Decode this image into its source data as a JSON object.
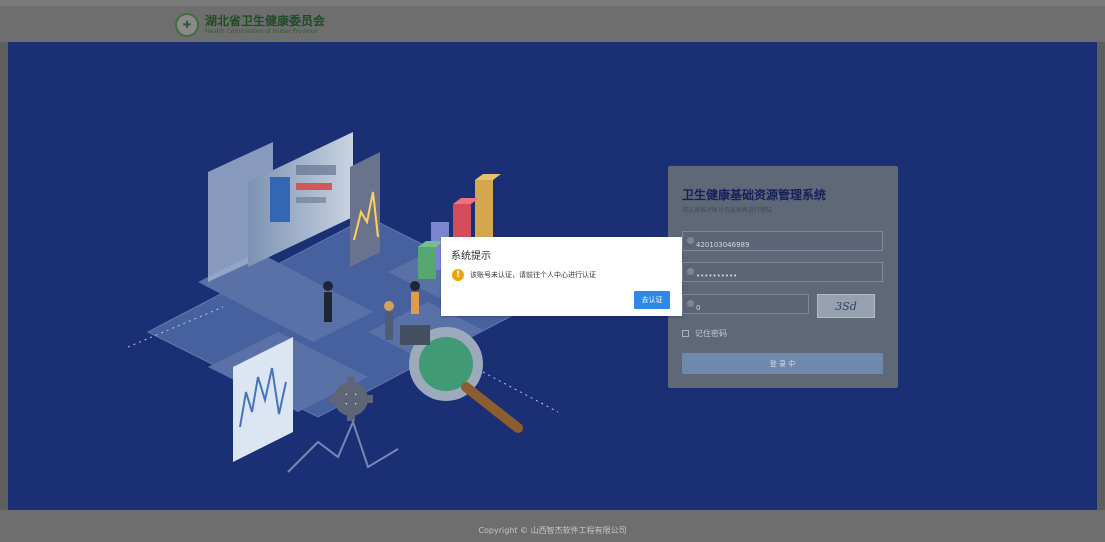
{
  "header": {
    "organization_cn": "湖北省卫生健康委员会",
    "organization_en": "Health Commission of Hubei Province"
  },
  "login": {
    "title": "卫生健康基础资源管理系统",
    "subtitle": "请认真核对账号信息后再进行登陆",
    "account_value": "420103046989",
    "password_value": "••••••••••",
    "captcha_value": "0",
    "captcha_image_text": "3Sd",
    "remember_label": "记住密码",
    "login_button": "登 录 中"
  },
  "dialog": {
    "title": "系统提示",
    "message": "该账号未认证，请前往个人中心进行认证",
    "button": "去认证"
  },
  "footer": {
    "copyright": "Copyright © 山西智杰软件工程有限公司"
  },
  "colors": {
    "main_background": "#1b2f75",
    "dialog_button": "#2f88e6",
    "warning_icon": "#f0a400"
  }
}
